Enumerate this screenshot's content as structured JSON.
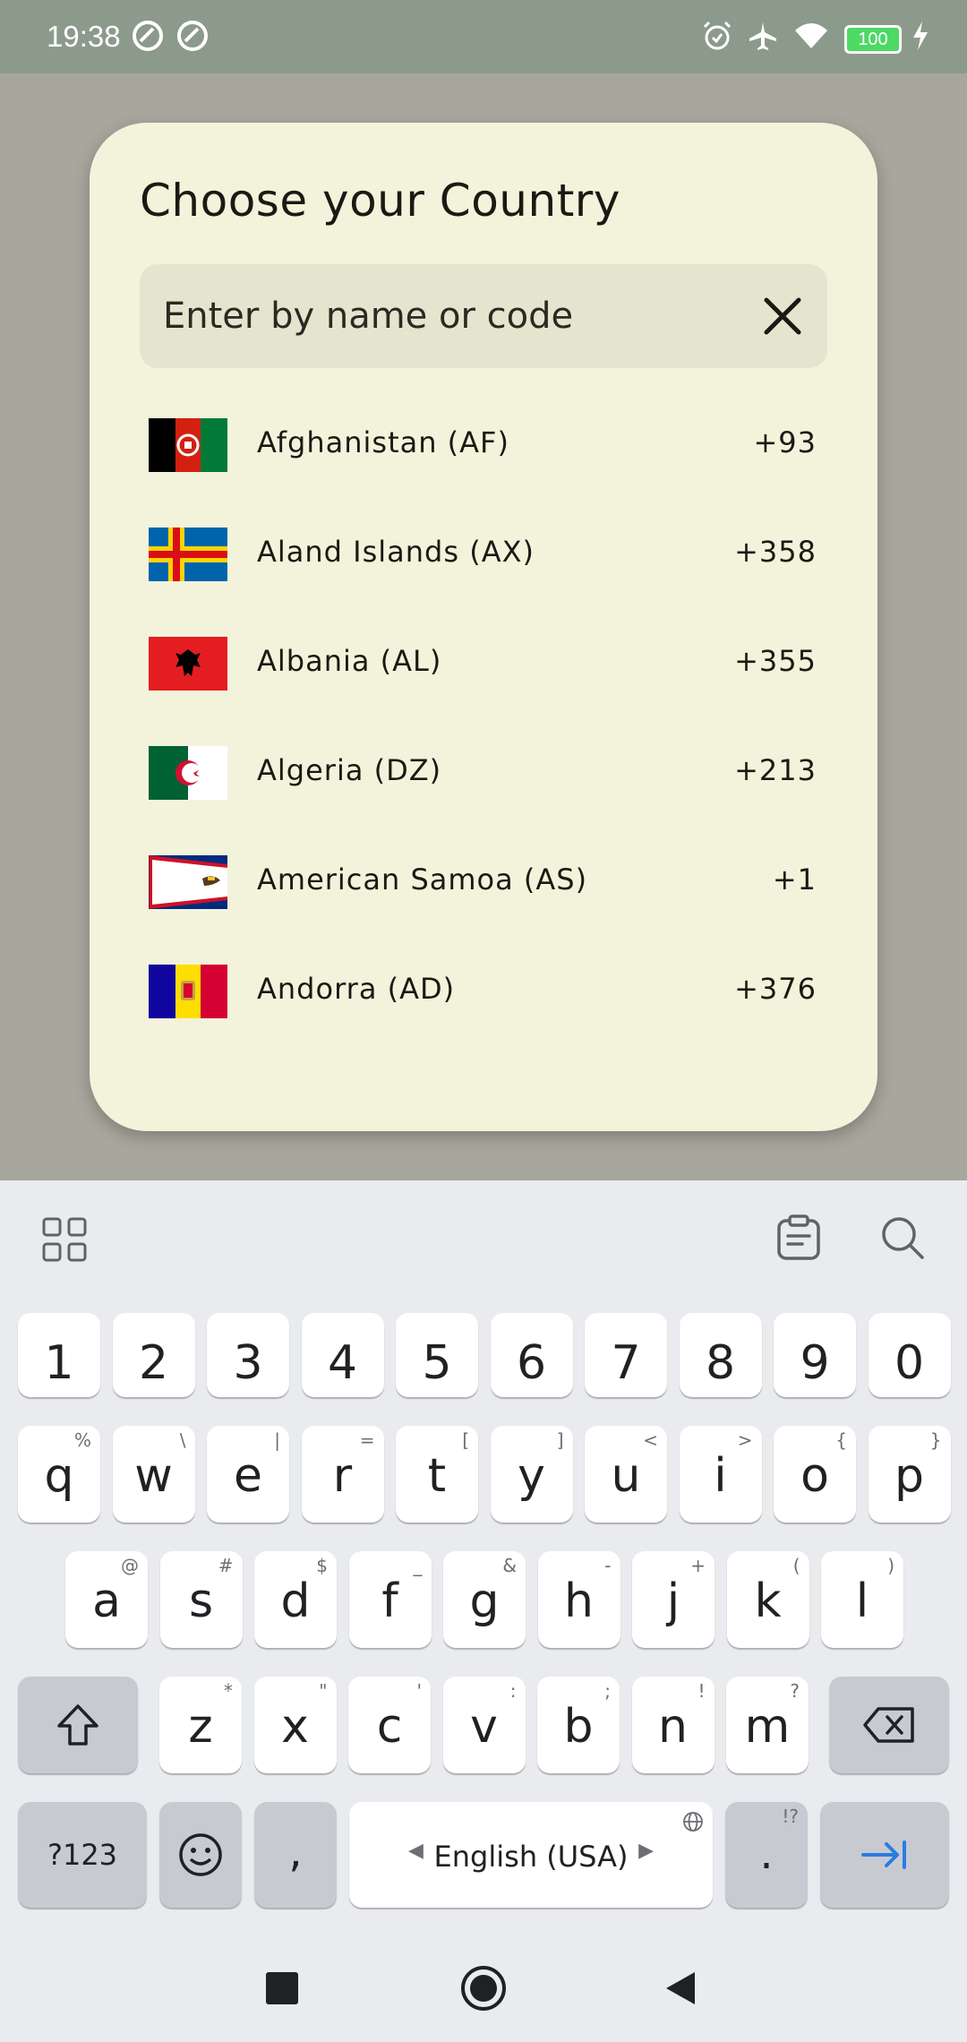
{
  "status_bar": {
    "time": "19:38",
    "battery": "100"
  },
  "dialog": {
    "title": "Choose your Country",
    "search_placeholder": "Enter by name or code"
  },
  "countries": [
    {
      "name": "Afghanistan (AF)",
      "code": "+93"
    },
    {
      "name": "Aland Islands (AX)",
      "code": "+358"
    },
    {
      "name": "Albania (AL)",
      "code": "+355"
    },
    {
      "name": "Algeria (DZ)",
      "code": "+213"
    },
    {
      "name": "American Samoa (AS)",
      "code": "+1"
    },
    {
      "name": "Andorra (AD)",
      "code": "+376"
    }
  ],
  "keyboard": {
    "numbers": [
      "1",
      "2",
      "3",
      "4",
      "5",
      "6",
      "7",
      "8",
      "9",
      "0"
    ],
    "row1": [
      {
        "k": "q",
        "h": "%"
      },
      {
        "k": "w",
        "h": "\\"
      },
      {
        "k": "e",
        "h": "|"
      },
      {
        "k": "r",
        "h": "="
      },
      {
        "k": "t",
        "h": "["
      },
      {
        "k": "y",
        "h": "]"
      },
      {
        "k": "u",
        "h": "<"
      },
      {
        "k": "i",
        "h": ">"
      },
      {
        "k": "o",
        "h": "{"
      },
      {
        "k": "p",
        "h": "}"
      }
    ],
    "row2": [
      {
        "k": "a",
        "h": "@"
      },
      {
        "k": "s",
        "h": "#"
      },
      {
        "k": "d",
        "h": "$"
      },
      {
        "k": "f",
        "h": "_"
      },
      {
        "k": "g",
        "h": "&"
      },
      {
        "k": "h",
        "h": "-"
      },
      {
        "k": "j",
        "h": "+"
      },
      {
        "k": "k",
        "h": "("
      },
      {
        "k": "l",
        "h": ")"
      }
    ],
    "row3": [
      {
        "k": "z",
        "h": "*"
      },
      {
        "k": "x",
        "h": "\""
      },
      {
        "k": "c",
        "h": "'"
      },
      {
        "k": "v",
        "h": ":"
      },
      {
        "k": "b",
        "h": ";"
      },
      {
        "k": "n",
        "h": "!"
      },
      {
        "k": "m",
        "h": "?"
      }
    ],
    "symbols_label": "?123",
    "comma": ",",
    "space_label": "English (USA)",
    "period": ".",
    "period_hint": "!?"
  },
  "colors": {
    "accent": "#2a7de1",
    "dialog_bg": "#f3f3dc",
    "scrim": "#a8a79d"
  }
}
